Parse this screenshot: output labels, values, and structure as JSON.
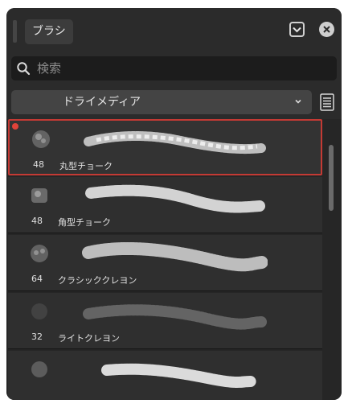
{
  "panel": {
    "tab_label": "ブラシ",
    "collapse_icon": "chevron-down-box-icon",
    "close_icon": "close-circle-icon"
  },
  "search": {
    "placeholder": "検索",
    "value": ""
  },
  "category": {
    "selected": "ドライメディア",
    "menu_icon": "list-menu-icon"
  },
  "colors": {
    "accent_selected": "#c43a34",
    "favorite_dot": "#e0433a",
    "panel_bg": "#2b2b2b"
  },
  "brushes": [
    {
      "size": "48",
      "name": "丸型チョーク",
      "selected": true,
      "favorite": true
    },
    {
      "size": "48",
      "name": "角型チョーク",
      "selected": false,
      "favorite": false
    },
    {
      "size": "64",
      "name": "クラシッククレヨン",
      "selected": false,
      "favorite": false
    },
    {
      "size": "32",
      "name": "ライトクレヨン",
      "selected": false,
      "favorite": false
    },
    {
      "size": "",
      "name": "",
      "selected": false,
      "favorite": false
    }
  ]
}
